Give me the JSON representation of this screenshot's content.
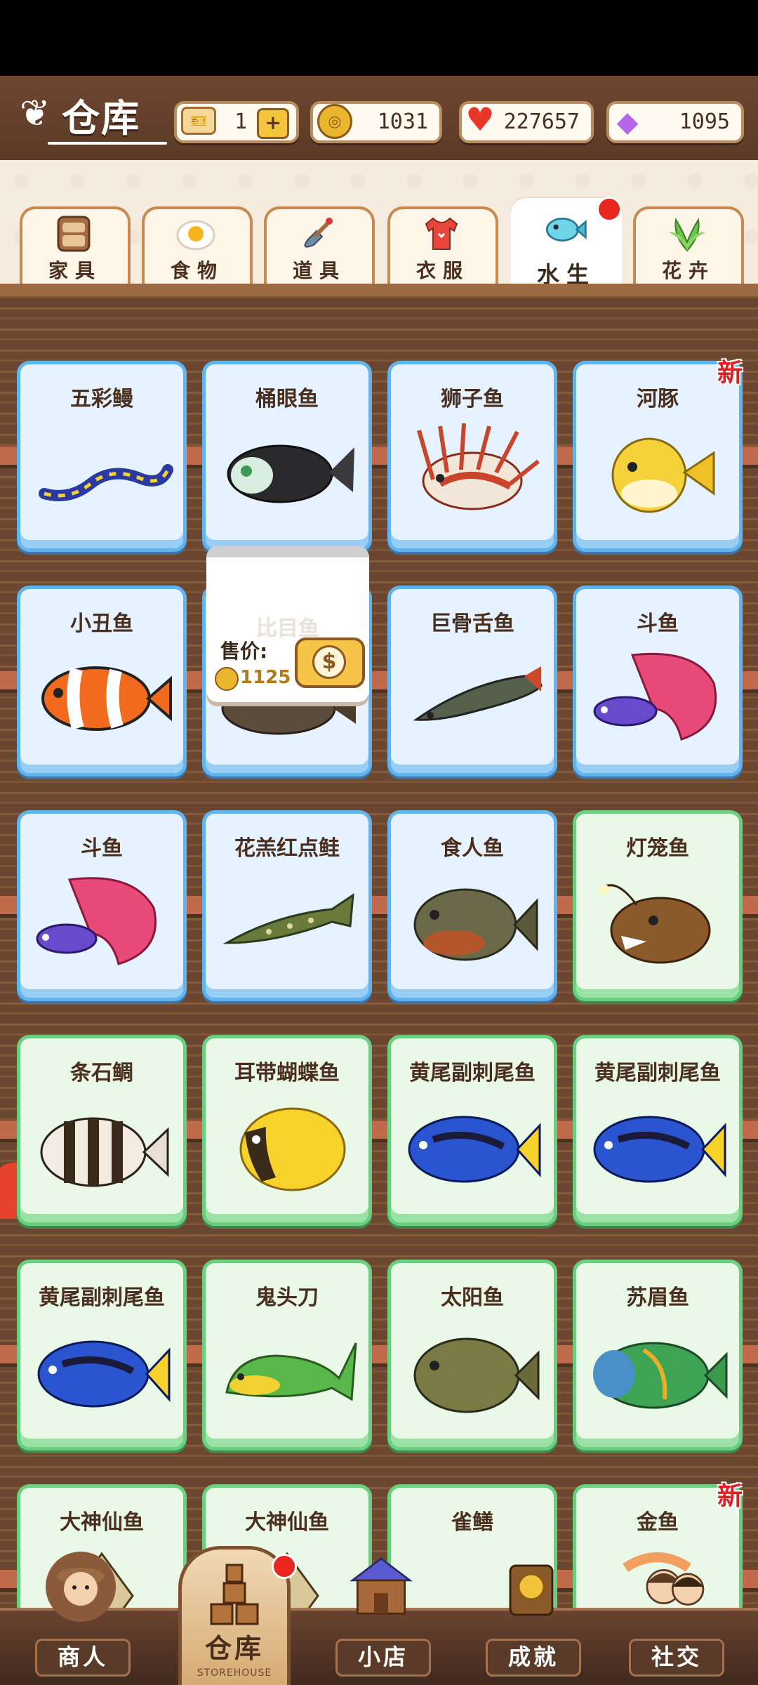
{
  "header": {
    "title": "仓库",
    "resources": {
      "ticket": "1",
      "coins": "1031",
      "hearts": "227657",
      "gems": "1095"
    }
  },
  "tabs": [
    {
      "label": "家具",
      "icon": "cabinet-icon"
    },
    {
      "label": "食物",
      "icon": "egg-icon"
    },
    {
      "label": "道具",
      "icon": "shovel-icon"
    },
    {
      "label": "衣服",
      "icon": "shirt-icon"
    },
    {
      "label": "水生",
      "icon": "fish-icon",
      "active": true
    },
    {
      "label": "花卉",
      "icon": "plant-icon"
    }
  ],
  "items": [
    {
      "name": "五彩鳗",
      "tier": "blue"
    },
    {
      "name": "桶眼鱼",
      "tier": "blue"
    },
    {
      "name": "狮子鱼",
      "tier": "blue"
    },
    {
      "name": "河豚",
      "tier": "blue",
      "new": "新"
    },
    {
      "name": "小丑鱼",
      "tier": "blue"
    },
    {
      "name": "比目鱼",
      "tier": "blue"
    },
    {
      "name": "巨骨舌鱼",
      "tier": "blue"
    },
    {
      "name": "斗鱼",
      "tier": "blue"
    },
    {
      "name": "斗鱼",
      "tier": "blue"
    },
    {
      "name": "花羔红点鲑",
      "tier": "blue"
    },
    {
      "name": "食人鱼",
      "tier": "blue"
    },
    {
      "name": "灯笼鱼",
      "tier": "green"
    },
    {
      "name": "条石鲷",
      "tier": "green"
    },
    {
      "name": "耳带蝴蝶鱼",
      "tier": "green"
    },
    {
      "name": "黄尾副刺尾鱼",
      "tier": "green"
    },
    {
      "name": "黄尾副刺尾鱼",
      "tier": "green"
    },
    {
      "name": "黄尾副刺尾鱼",
      "tier": "green"
    },
    {
      "name": "鬼头刀",
      "tier": "green"
    },
    {
      "name": "太阳鱼",
      "tier": "green"
    },
    {
      "name": "苏眉鱼",
      "tier": "green"
    },
    {
      "name": "大神仙鱼",
      "tier": "green"
    },
    {
      "name": "大神仙鱼",
      "tier": "green"
    },
    {
      "name": "雀鳝",
      "tier": "green"
    },
    {
      "name": "金鱼",
      "tier": "green",
      "new": "新"
    }
  ],
  "popup": {
    "price_label": "售价:",
    "price": "1125"
  },
  "nav": {
    "merchant": "商人",
    "storage": "仓库",
    "storage_sub": "STOREHOUSE",
    "shop": "小店",
    "achievement": "成就",
    "social": "社交"
  },
  "colors": {
    "blue_card_border": "#60b4f0",
    "green_card_border": "#68d07e",
    "new_badge": "#e02020",
    "notify_dot": "#e8261e"
  }
}
